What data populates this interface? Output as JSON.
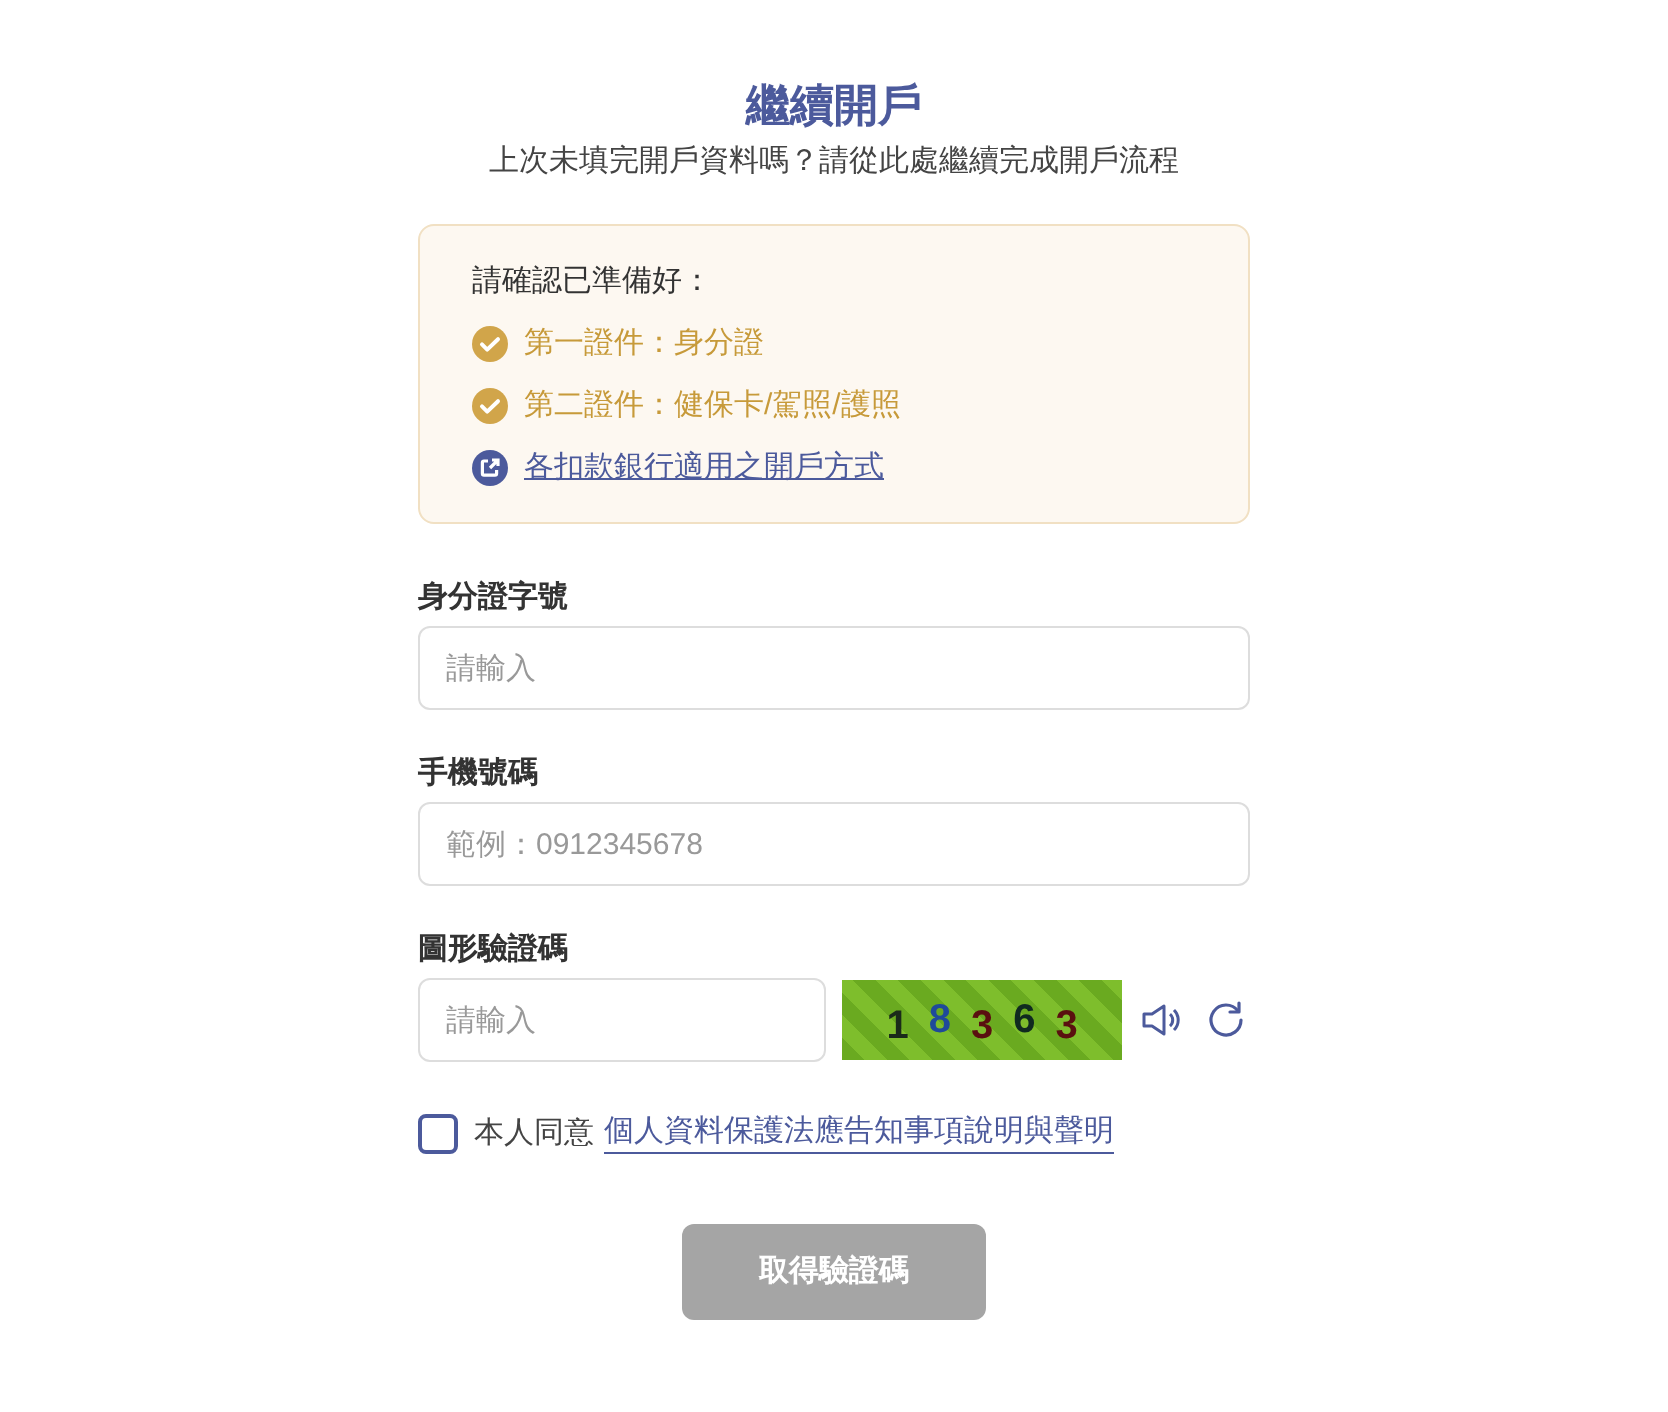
{
  "title": "繼續開戶",
  "subtitle": "上次未填完開戶資料嗎？請從此處繼續完成開戶流程",
  "checklist": {
    "heading": "請確認已準備好：",
    "items": [
      {
        "kind": "check",
        "text": "第一證件：身分證"
      },
      {
        "kind": "check",
        "text": "第二證件：健保卡/駕照/護照"
      },
      {
        "kind": "link",
        "text": "各扣款銀行適用之開戶方式"
      }
    ]
  },
  "fields": [
    {
      "label": "身分證字號",
      "placeholder": "請輸入"
    },
    {
      "label": "手機號碼",
      "placeholder": "範例：0912345678"
    }
  ],
  "captcha": {
    "label": "圖形驗證碼",
    "placeholder": "請輸入",
    "chars": [
      {
        "text": "1",
        "color": "#1a2a1a"
      },
      {
        "text": "8",
        "color": "#1f4a9a"
      },
      {
        "text": "3",
        "color": "#5a1010"
      },
      {
        "text": "6",
        "color": "#102a20"
      },
      {
        "text": "3",
        "color": "#5a1010"
      }
    ]
  },
  "consent": {
    "checked": false,
    "text": "本人同意",
    "link": "個人資料保護法應告知事項說明與聲明"
  },
  "submit": {
    "label": "取得驗證碼",
    "disabled": true
  }
}
